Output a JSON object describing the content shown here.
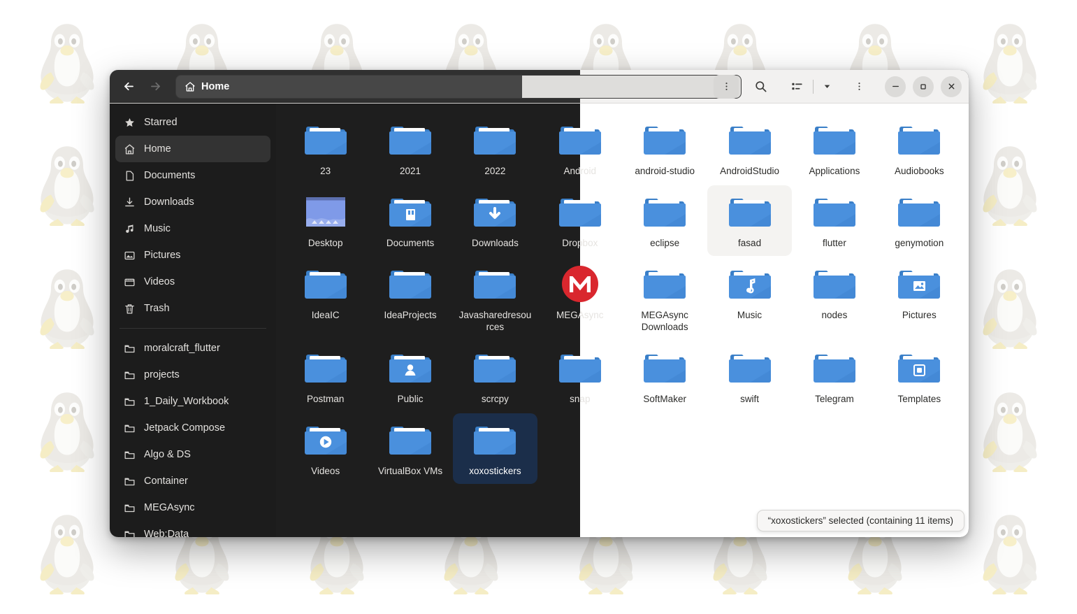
{
  "desktop": {
    "wallpaper_icon": "tux-penguin",
    "background_color": "#ffffff"
  },
  "window": {
    "title": "Home",
    "theme_split_note": "left dark / right light",
    "nav": {
      "back_label": "Back",
      "forward_label": "Forward",
      "back_icon": "arrow-left-icon",
      "forward_icon": "arrow-right-icon"
    },
    "pathbar": {
      "icon": "home-icon",
      "label": "Home"
    },
    "toolbar": {
      "path_menu_icon": "kebab-menu-icon",
      "search_icon": "search-icon",
      "view_list_icon": "view-list-icon",
      "view_dropdown_icon": "chevron-down-icon",
      "app_menu_icon": "kebab-menu-icon",
      "minimize_icon": "minimize-icon",
      "maximize_icon": "maximize-icon",
      "close_icon": "close-icon"
    }
  },
  "sidebar": {
    "places": [
      {
        "label": "Starred",
        "icon": "star-icon",
        "active": false
      },
      {
        "label": "Home",
        "icon": "home-icon",
        "active": true
      },
      {
        "label": "Documents",
        "icon": "document-icon",
        "active": false
      },
      {
        "label": "Downloads",
        "icon": "download-icon",
        "active": false
      },
      {
        "label": "Music",
        "icon": "music-note-icon",
        "active": false
      },
      {
        "label": "Pictures",
        "icon": "image-icon",
        "active": false
      },
      {
        "label": "Videos",
        "icon": "video-icon",
        "active": false
      },
      {
        "label": "Trash",
        "icon": "trash-icon",
        "active": false
      }
    ],
    "bookmarks": [
      {
        "label": "moralcraft_flutter",
        "icon": "folder-icon"
      },
      {
        "label": "projects",
        "icon": "folder-icon"
      },
      {
        "label": "1_Daily_Workbook",
        "icon": "folder-icon"
      },
      {
        "label": "Jetpack Compose",
        "icon": "folder-icon"
      },
      {
        "label": "Algo & DS",
        "icon": "folder-icon"
      },
      {
        "label": "Container",
        "icon": "folder-icon"
      },
      {
        "label": "MEGAsync",
        "icon": "folder-icon"
      },
      {
        "label": "Web:Data",
        "icon": "folder-icon"
      }
    ]
  },
  "files": [
    {
      "name": "23",
      "icon": "folder-plain"
    },
    {
      "name": "2021",
      "icon": "folder-plain"
    },
    {
      "name": "2022",
      "icon": "folder-plain"
    },
    {
      "name": "Android",
      "icon": "folder-plain"
    },
    {
      "name": "android-studio",
      "icon": "folder-plain"
    },
    {
      "name": "AndroidStudio",
      "icon": "folder-plain"
    },
    {
      "name": "Applications",
      "icon": "folder-plain"
    },
    {
      "name": "Audiobooks",
      "icon": "folder-plain"
    },
    {
      "name": "Desktop",
      "icon": "desktop-thumbnail"
    },
    {
      "name": "Documents",
      "icon": "folder-documents"
    },
    {
      "name": "Downloads",
      "icon": "folder-downloads"
    },
    {
      "name": "Dropbox",
      "icon": "folder-plain"
    },
    {
      "name": "eclipse",
      "icon": "folder-plain"
    },
    {
      "name": "fasad",
      "icon": "folder-plain",
      "state": "hovered"
    },
    {
      "name": "flutter",
      "icon": "folder-plain"
    },
    {
      "name": "genymotion",
      "icon": "folder-plain"
    },
    {
      "name": "IdeaIC",
      "icon": "folder-plain"
    },
    {
      "name": "IdeaProjects",
      "icon": "folder-plain"
    },
    {
      "name": "Javasharedresources",
      "icon": "folder-plain"
    },
    {
      "name": "MEGAsync",
      "icon": "mega-logo"
    },
    {
      "name": "MEGAsync Downloads",
      "icon": "folder-plain"
    },
    {
      "name": "Music",
      "icon": "folder-music"
    },
    {
      "name": "nodes",
      "icon": "folder-plain"
    },
    {
      "name": "Pictures",
      "icon": "folder-pictures"
    },
    {
      "name": "Postman",
      "icon": "folder-plain"
    },
    {
      "name": "Public",
      "icon": "folder-public"
    },
    {
      "name": "scrcpy",
      "icon": "folder-plain"
    },
    {
      "name": "snap",
      "icon": "folder-plain"
    },
    {
      "name": "SoftMaker",
      "icon": "folder-plain"
    },
    {
      "name": "swift",
      "icon": "folder-plain"
    },
    {
      "name": "Telegram",
      "icon": "folder-plain"
    },
    {
      "name": "Templates",
      "icon": "folder-templates"
    },
    {
      "name": "Videos",
      "icon": "folder-videos"
    },
    {
      "name": "VirtualBox VMs",
      "icon": "folder-plain"
    },
    {
      "name": "xoxostickers",
      "icon": "folder-plain",
      "state": "selected"
    }
  ],
  "statusbar": {
    "text": "“xoxostickers” selected  (containing 11 items)"
  },
  "colors": {
    "folder_blue": "#4a90dd",
    "folder_blue_dark": "#3a7fc8",
    "mega_red": "#d9272e",
    "selection_blue": "#1b2e4a",
    "dark_bg": "#1e1e1e",
    "sidebar_bg": "#1c1c1c",
    "light_bg": "#ffffff",
    "header_light": "#f2f1f0",
    "header_dark": "#303030"
  }
}
